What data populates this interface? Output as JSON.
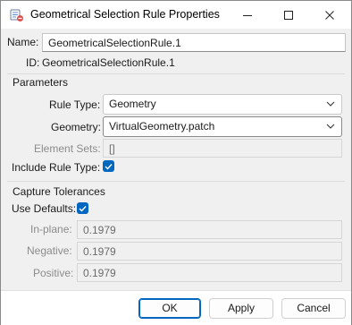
{
  "window": {
    "title": "Geometrical Selection Rule Properties"
  },
  "name_row": {
    "label": "Name:",
    "value": "GeometricalSelectionRule.1"
  },
  "id_row": {
    "label": "ID:",
    "value": "GeometricalSelectionRule.1"
  },
  "parameters": {
    "title": "Parameters",
    "rule_type": {
      "label": "Rule Type:",
      "value": "Geometry"
    },
    "geometry": {
      "label": "Geometry:",
      "value": "VirtualGeometry.patch"
    },
    "element_sets": {
      "label": "Element Sets:",
      "value": "[]"
    },
    "include_rule_type": {
      "label": "Include Rule Type:",
      "checked": true
    }
  },
  "capture": {
    "title": "Capture Tolerances",
    "use_defaults": {
      "label": "Use Defaults:",
      "checked": true
    },
    "in_plane": {
      "label": "In-plane:",
      "value": "0.1979"
    },
    "negative": {
      "label": "Negative:",
      "value": "0.1979"
    },
    "positive": {
      "label": "Positive:",
      "value": "0.1979"
    }
  },
  "buttons": {
    "ok": "OK",
    "apply": "Apply",
    "cancel": "Cancel"
  },
  "colors": {
    "accent": "#0067c0"
  }
}
